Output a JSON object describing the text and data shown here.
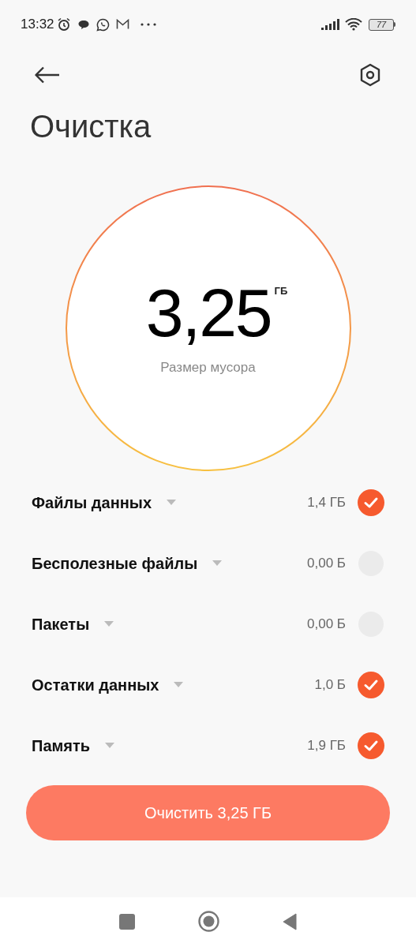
{
  "status_bar": {
    "time": "13:32",
    "battery": "77"
  },
  "title": "Очистка",
  "summary": {
    "value": "3,25",
    "unit": "ГБ",
    "caption": "Размер мусора"
  },
  "items": [
    {
      "label": "Файлы данных",
      "size": "1,4 ГБ",
      "checked": true
    },
    {
      "label": "Бесполезные файлы",
      "size": "0,00 Б",
      "checked": false
    },
    {
      "label": "Пакеты",
      "size": "0,00 Б",
      "checked": false
    },
    {
      "label": "Остатки данных",
      "size": "1,0 Б",
      "checked": true
    },
    {
      "label": "Память",
      "size": "1,9 ГБ",
      "checked": true
    }
  ],
  "action_button": "Очистить 3,25 ГБ"
}
